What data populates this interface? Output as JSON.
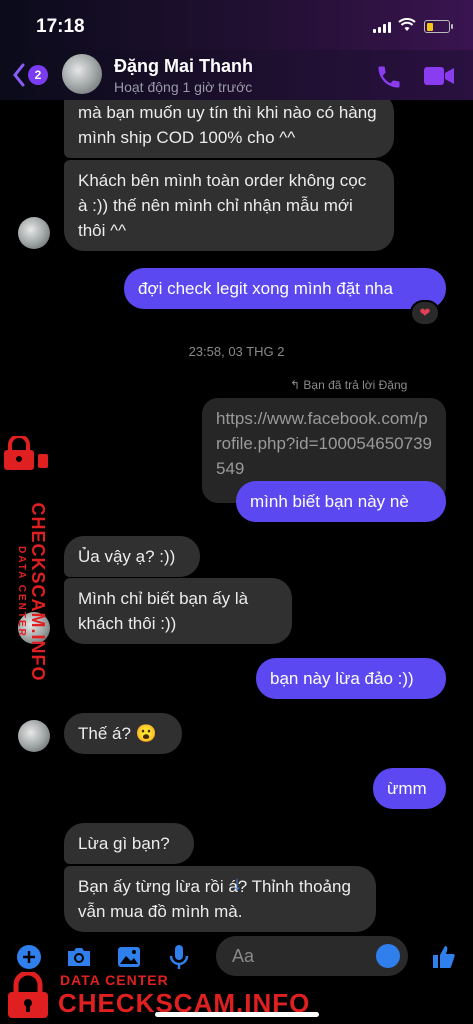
{
  "status_bar": {
    "time": "17:18",
    "battery_level": 0.3
  },
  "header": {
    "unread_count": "2",
    "contact_name": "Đặng Mai Thanh",
    "contact_status": "Hoạt động 1 giờ trước"
  },
  "messages": [
    {
      "text": "mà bạn muốn uy tín thì khi nào có hàng mình ship COD 100% cho ^^"
    },
    {
      "text": "Khách bên mình toàn order không cọc à :)) thế nên mình chỉ nhận mẫu mới thôi ^^"
    },
    {
      "text": "đợi check legit xong mình đặt nha",
      "reaction": "❤"
    },
    {
      "text": "https://www.facebook.com/profile.php?id=100054650739549"
    },
    {
      "text": "mình biết bạn này nè"
    },
    {
      "text": "Ủa vậy ạ? :))"
    },
    {
      "text": "Mình chỉ biết bạn ấy là khách thôi :))"
    },
    {
      "text": "bạn này lừa đảo :))"
    },
    {
      "text": "Thế á? 😮"
    },
    {
      "text": "ừmm"
    },
    {
      "text": "Lừa gì bạn?"
    },
    {
      "text": "Bạn ấy từng lừa rồi á? Thỉnh thoảng vẫn mua đồ mình mà."
    }
  ],
  "timestamp": "23:58, 03 THG 2",
  "reply_note": "Bạn đã trả lời Đặng",
  "composer": {
    "placeholder": "Aa"
  },
  "watermark": {
    "sub": "DATA CENTER",
    "main": "CHECKSCAM.INFO"
  },
  "colors": {
    "sent_bubble": "#5b48f0",
    "received_bubble": "#303030",
    "accent": "#7a3cf0",
    "watermark": "#e02020"
  }
}
